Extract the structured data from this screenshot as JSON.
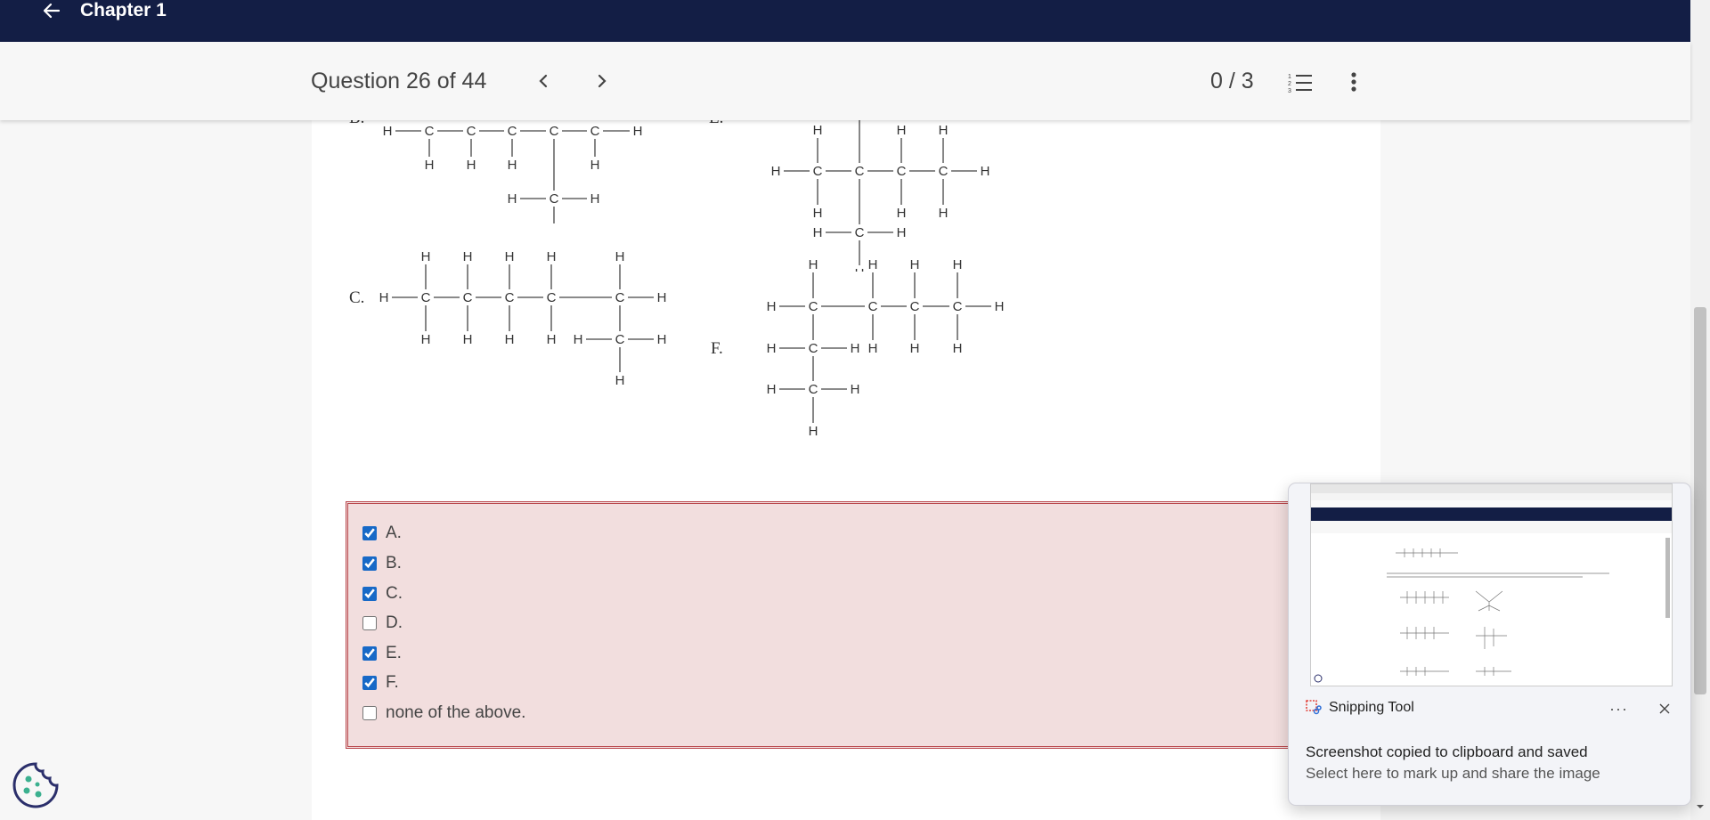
{
  "header": {
    "chapter_title": "Chapter 1"
  },
  "subbar": {
    "question_counter": "Question 26 of 44",
    "score": "0 / 3"
  },
  "molecules": {
    "labels": {
      "b": "B.",
      "c": "C.",
      "e": "E.",
      "f": "F."
    },
    "atom_h": "H",
    "atom_c": "C"
  },
  "answers": {
    "options": [
      {
        "label": "A.",
        "checked": true
      },
      {
        "label": "B.",
        "checked": true
      },
      {
        "label": "C.",
        "checked": true
      },
      {
        "label": "D.",
        "checked": false
      },
      {
        "label": "E.",
        "checked": true
      },
      {
        "label": "F.",
        "checked": true
      },
      {
        "label": "none of the above.",
        "checked": false
      }
    ]
  },
  "toast": {
    "app_name": "Snipping Tool",
    "more": "···",
    "title": "Screenshot copied to clipboard and saved",
    "body": "Select here to mark up and share the image"
  },
  "colors": {
    "topbar": "#131e45",
    "answer_bg": "#f2dede",
    "answer_border": "#b9484d",
    "checkbox": "#1769c7"
  }
}
